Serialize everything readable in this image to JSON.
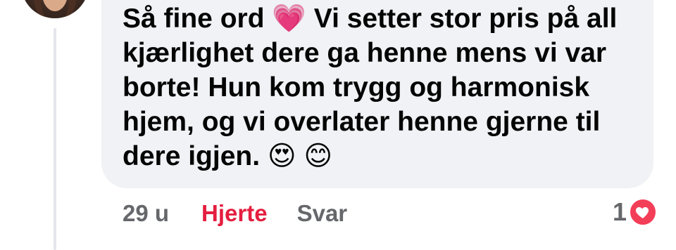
{
  "comment": {
    "text": "Så fine ord 💗 Vi setter stor pris på all kjærlighet dere ga henne mens vi var borte! Hun kom trygg og harmonisk hjem, og vi overlater henne gjerne til dere igjen. 😍 😊"
  },
  "actions": {
    "timestamp": "29 u",
    "heart_label": "Hjerte",
    "reply_label": "Svar"
  },
  "reactions": {
    "count": "1",
    "icon": "heart-icon",
    "color": "#f33e58"
  },
  "colors": {
    "bubble": "#f0f2f5",
    "text": "#050505",
    "muted": "#65676b",
    "heart_active": "#e41e3f"
  }
}
